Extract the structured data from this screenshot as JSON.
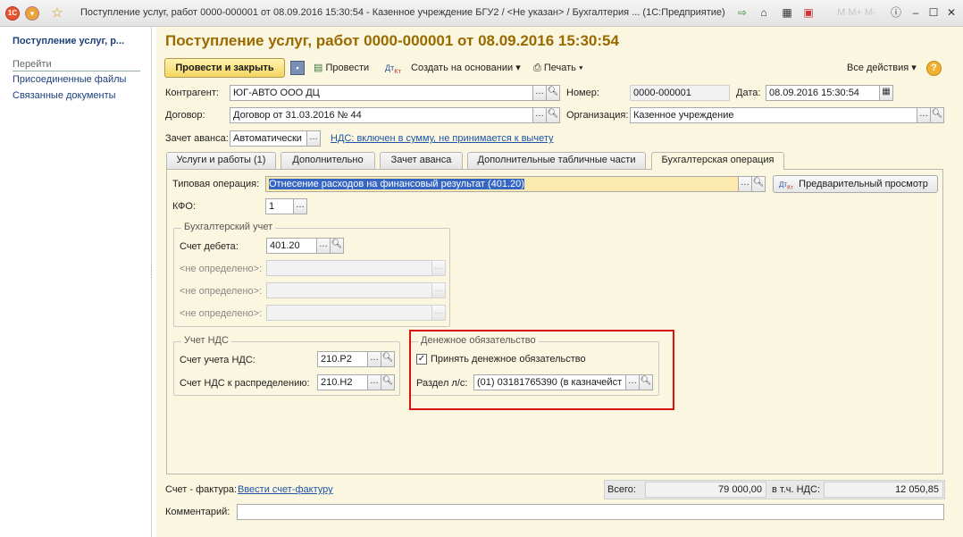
{
  "window": {
    "title": "Поступление услуг, работ 0000-000001 от 08.09.2016 15:30:54 - Казенное учреждение БГУ2 / <Не указан> / Бухгалтерия ... (1С:Предприятие)",
    "title_right_faded": "М М+ М-"
  },
  "sidebar": {
    "doc_title": "Поступление услуг, р...",
    "section": "Перейти",
    "links": [
      "Присоединенные файлы",
      "Связанные документы"
    ]
  },
  "document": {
    "title": "Поступление услуг, работ 0000-000001 от 08.09.2016 15:30:54"
  },
  "toolbar": {
    "post_close": "Провести и закрыть",
    "post": "Провести",
    "create_based": "Создать на основании",
    "print": "Печать",
    "all_actions": "Все действия"
  },
  "header": {
    "counterparty_label": "Контрагент:",
    "counterparty_value": "ЮГ-АВТО ООО ДЦ",
    "number_label": "Номер:",
    "number_value": "0000-000001",
    "date_label": "Дата:",
    "date_value": "08.09.2016 15:30:54",
    "contract_label": "Договор:",
    "contract_value": "Договор от 31.03.2016 № 44",
    "org_label": "Организация:",
    "org_value": "Казенное учреждение",
    "advance_label": "Зачет аванса:",
    "advance_value": "Автоматически",
    "vat_link": "НДС: включен в сумму, не принимается к вычету"
  },
  "tabs": [
    "Услуги и работы (1)",
    "Дополнительно",
    "Зачет аванса",
    "Дополнительные табличные части",
    "Бухгалтерская операция"
  ],
  "operation": {
    "typical_label": "Типовая операция:",
    "typical_value": "Отнесение расходов на финансовый результат (401.20)",
    "preview_button": "Предварительный просмотр",
    "kfo_label": "КФО:",
    "kfo_value": "1"
  },
  "accounting": {
    "title": "Бухгалтерский учет",
    "debit_label": "Счет дебета:",
    "debit_value": "401.20",
    "undefined_label": "<не определено>:"
  },
  "vat_accounting": {
    "title": "Учет НДС",
    "vat_account_label": "Счет учета НДС:",
    "vat_account_value": "210.Р2",
    "vat_dist_label": "Счет НДС к распределению:",
    "vat_dist_value": "210.Н2"
  },
  "monetary": {
    "title": "Денежное обязательство",
    "accept_label": "Принять денежное обязательство",
    "accept_checked": true,
    "section_label": "Раздел л/с:",
    "section_value": "(01) 03181765390 (в казначейст"
  },
  "footer": {
    "invoice_label": "Счет - фактура:",
    "invoice_link": "Ввести счет-фактуру",
    "total_label": "Всего:",
    "total_value": "79 000,00",
    "vat_label": "в т.ч. НДС:",
    "vat_value": "12 050,85",
    "comment_label": "Комментарий:",
    "comment_value": ""
  },
  "colors": {
    "accent": "#9a6a00",
    "highlight": "#e01010",
    "background": "#fbf6df"
  }
}
